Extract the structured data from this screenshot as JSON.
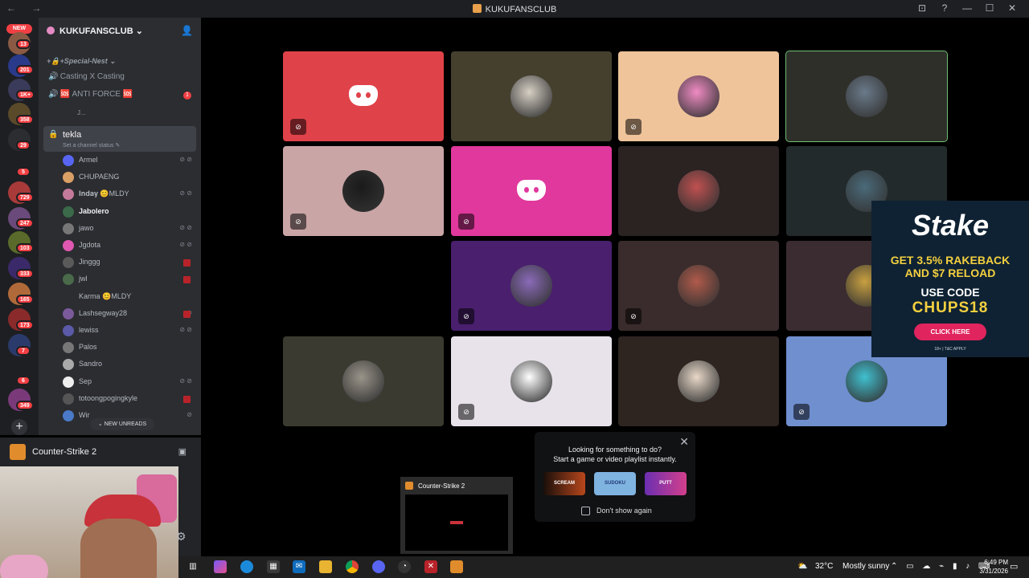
{
  "window": {
    "title": "KUKUFANSCLUB",
    "nav": "← →",
    "controls": [
      "⊡",
      "?",
      "—",
      "☐",
      "✕"
    ]
  },
  "rail": {
    "new_label": "NEW",
    "badges": [
      "13",
      "201",
      "1K+",
      "358",
      "29",
      "5",
      "729",
      "247",
      "103",
      "333",
      "165",
      "173",
      "7",
      "6",
      "349"
    ],
    "add_label": "+"
  },
  "sidebar": {
    "server_name": "KUKUFANSCLUB ⌄",
    "invite_icon": "👤",
    "category": "+🔒+Special-Nest ⌄",
    "channels": [
      {
        "label": "Casting X Casting",
        "icon": "🔊"
      },
      {
        "label": "🆘 ANTI FORCE 🆘",
        "icon": "🔊",
        "badge": "1"
      },
      {
        "label": "J...",
        "icon": ""
      }
    ],
    "active_channel": {
      "name": "tekla",
      "status": "Set a channel status ✎"
    },
    "members": [
      {
        "name": "Armel",
        "icons": "⊘ ⊘"
      },
      {
        "name": "CHUPAENG",
        "icons": ""
      },
      {
        "name": "𝐈𝐧𝐝𝐚𝐲 😊MLDY",
        "icons": "⊘ ⊘"
      },
      {
        "name": "Jabolero",
        "icons": ""
      },
      {
        "name": "jawo",
        "icons": "⊘ ⊘"
      },
      {
        "name": "Jgdota",
        "icons": "⊘ ⊘"
      },
      {
        "name": "Jinggg",
        "icons": ""
      },
      {
        "name": "jwl",
        "icons": ""
      },
      {
        "name": "Karma 😊MLDY",
        "icons": ""
      },
      {
        "name": "Lashsegway28",
        "icons": "⊘"
      },
      {
        "name": "lewiss",
        "icons": "⊘ ⊘"
      },
      {
        "name": "Palos",
        "icons": ""
      },
      {
        "name": "Sandro",
        "icons": ""
      },
      {
        "name": "Sep",
        "icons": "⊘ ⊘"
      },
      {
        "name": "totoongpogingkyle",
        "icons": ""
      },
      {
        "name": "Wir",
        "icons": "⊘"
      }
    ],
    "new_unreads": "⌄ NEW UNREADS"
  },
  "game_activity": {
    "name": "Counter-Strike 2",
    "icon": "monitor-icon"
  },
  "ad": {
    "brand": "Stake",
    "line1": "GET 3.5% RAKEBACK",
    "line2": "AND $7 RELOAD",
    "line3": "USE CODE",
    "code": "CHUPS18",
    "cta": "CLICK HERE",
    "terms": "18+ | T&C APPLY"
  },
  "activity_prompt": {
    "line1": "Looking for something to do?",
    "line2": "Start a game or video playlist instantly.",
    "games": [
      "SCREAM",
      "SUDOKU",
      "PUTT"
    ],
    "checkbox_label": "Don't show again",
    "close": "✕"
  },
  "taskbar_preview": {
    "title": "Counter-Strike 2"
  },
  "taskbar": {
    "weather_temp": "32°C",
    "weather_text": "Mostly sunny",
    "time": "6:49 PM",
    "date": "3/31/2026",
    "tray_icons": "⌃ ▭ ☁ ⌁ ▮ ♪ ⌨"
  },
  "colors": {
    "accent": "#5865f2",
    "danger": "#f23f43",
    "speaking": "#6fbf73"
  }
}
